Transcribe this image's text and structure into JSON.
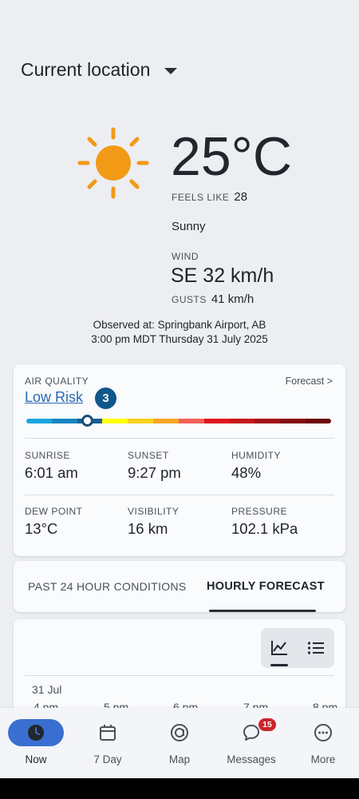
{
  "location": {
    "name": "Current location"
  },
  "current": {
    "temperature": "25°C",
    "feels_like_label": "FEELS LIKE",
    "feels_like_value": "28",
    "condition": "Sunny",
    "wind_label": "WIND",
    "wind_value": "SE 32 km/h",
    "gusts_label": "GUSTS",
    "gusts_value": "41 km/h",
    "observed_line1": "Observed at: Springbank Airport, AB",
    "observed_line2": "3:00 pm MDT Thursday 31 July 2025",
    "icon": "sun-icon",
    "icon_color": "#f29a16"
  },
  "air_quality": {
    "label": "AIR QUALITY",
    "forecast_link": "Forecast >",
    "risk_text": "Low Risk",
    "index": "3",
    "scale_level": 0.2,
    "scale_colors": [
      "#19a6e0",
      "#1784c0",
      "#1a5f94",
      "#ffff00",
      "#f9d01a",
      "#f5a623",
      "#f0605a",
      "#e0141c",
      "#c6131a",
      "#a30f14",
      "#870c10",
      "#6a0808"
    ]
  },
  "stats": {
    "sunrise": {
      "label": "SUNRISE",
      "value": "6:01 am"
    },
    "sunset": {
      "label": "SUNSET",
      "value": "9:27 pm"
    },
    "humidity": {
      "label": "HUMIDITY",
      "value": "48%"
    },
    "dew_point": {
      "label": "DEW POINT",
      "value": "13°C"
    },
    "visibility": {
      "label": "VISIBILITY",
      "value": "16 km"
    },
    "pressure": {
      "label": "PRESSURE",
      "value": "102.1 kPa"
    }
  },
  "tabs": {
    "past": "PAST 24 HOUR CONDITIONS",
    "hourly": "HOURLY FORECAST",
    "active": "hourly"
  },
  "hourly": {
    "date": "31 Jul",
    "hours": [
      "4 pm",
      "5 pm",
      "6 pm",
      "7 pm",
      "8 pm"
    ],
    "view": "chart"
  },
  "nav": {
    "items": [
      {
        "label": "Now",
        "icon": "clock-icon",
        "active": true
      },
      {
        "label": "7 Day",
        "icon": "calendar-icon"
      },
      {
        "label": "Map",
        "icon": "map-icon"
      },
      {
        "label": "Messages",
        "icon": "messages-icon",
        "badge": "15"
      },
      {
        "label": "More",
        "icon": "more-icon"
      }
    ]
  }
}
